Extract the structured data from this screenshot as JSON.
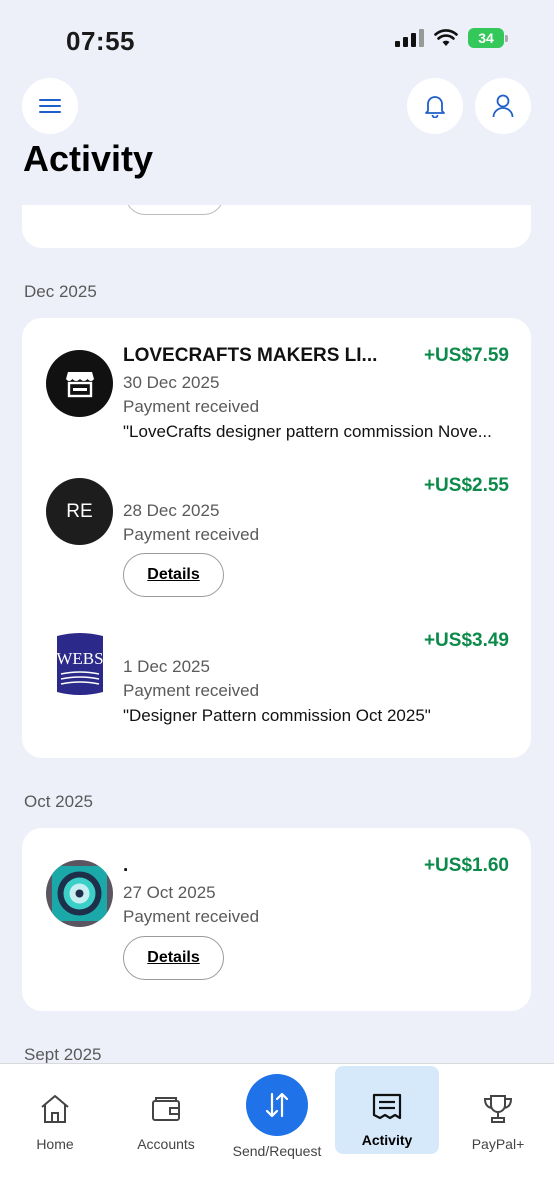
{
  "status_bar": {
    "time": "07:55",
    "battery": "34"
  },
  "header": {
    "title": "Activity"
  },
  "sections": [
    {
      "month": "Dec 2025",
      "transactions": [
        {
          "avatar_type": "store-icon",
          "name": "LOVECRAFTS MAKERS LI...",
          "amount": "+US$7.59",
          "date": "30 Dec 2025",
          "status": "Payment received",
          "note": "\"LoveCrafts designer pattern commission Nove..."
        },
        {
          "avatar_type": "initials",
          "initials": "RE",
          "name": "",
          "amount": "+US$2.55",
          "date": "28 Dec 2025",
          "status": "Payment received",
          "details_label": "Details"
        },
        {
          "avatar_type": "logo",
          "logo_text": "WEBS",
          "name": "",
          "amount": "+US$3.49",
          "date": "1 Dec 2025",
          "status": "Payment received",
          "note": "\"Designer Pattern commission Oct 2025\""
        }
      ]
    },
    {
      "month": "Oct 2025",
      "transactions": [
        {
          "avatar_type": "photo",
          "name": ".",
          "amount": "+US$1.60",
          "date": "27 Oct 2025",
          "status": "Payment received",
          "details_label": "Details"
        }
      ]
    },
    {
      "month": "Sept 2025"
    }
  ],
  "bottom_nav": {
    "home": "Home",
    "accounts": "Accounts",
    "send_request": "Send/Request",
    "activity": "Activity",
    "paypal_plus": "PayPal+"
  },
  "colors": {
    "accent": "#1f72e8",
    "positive": "#0b8a4a",
    "active_tab_bg": "#d6e9fb"
  }
}
